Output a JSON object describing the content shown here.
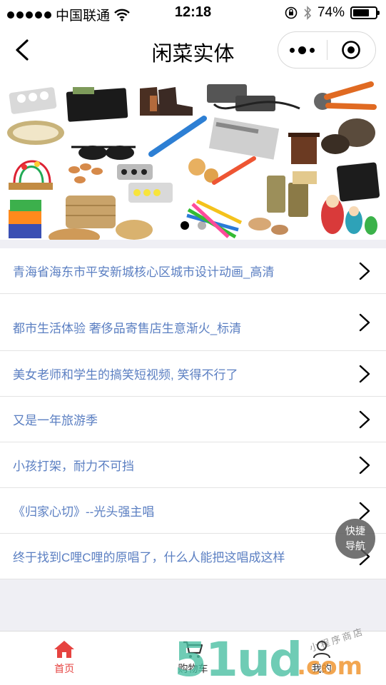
{
  "status_bar": {
    "carrier": "中国联通",
    "time": "12:18",
    "battery": "74%",
    "battery_level": 0.74
  },
  "nav": {
    "title": "闲菜实体"
  },
  "banner": {
    "page_count": 2,
    "active_page": 0
  },
  "list": {
    "items": [
      {
        "label": "青海省海东市平安新城核心区城市设计动画_高清"
      },
      {
        "label": "都市生活体验 奢侈品寄售店生意渐火_标清"
      },
      {
        "label": "美女老师和学生的搞笑短视频, 笑得不行了"
      },
      {
        "label": "又是一年旅游季"
      },
      {
        "label": "小孩打架，耐力不可挡"
      },
      {
        "label": "《归家心切》--光头强主唱"
      },
      {
        "label": "终于找到C哩C哩的原唱了，什么人能把这唱成这样"
      }
    ]
  },
  "fab": {
    "line1": "快捷",
    "line2": "导航"
  },
  "tab_bar": {
    "tabs": [
      {
        "label": "首页",
        "active": true
      },
      {
        "label": "购物车",
        "active": false
      },
      {
        "label": "我的",
        "active": false
      }
    ]
  },
  "watermark": {
    "main": "51ud",
    "suffix": ".com",
    "small": "小程序商店"
  },
  "colors": {
    "link_text": "#5b7fc2",
    "tab_active": "#e64340",
    "tab_inactive": "#333333",
    "background": "#efeff4"
  }
}
